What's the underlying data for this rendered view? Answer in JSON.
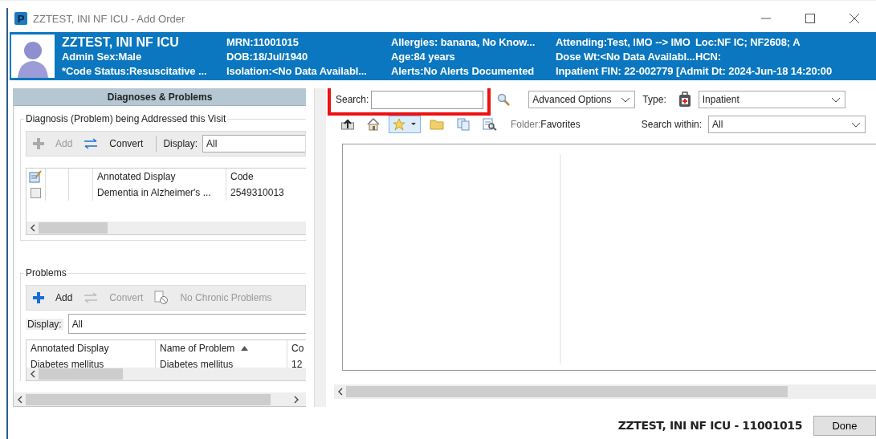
{
  "window": {
    "app_letter": "P",
    "title": "ZZTEST, INI NF ICU - Add Order"
  },
  "banner": {
    "rows": [
      [
        "ZZTEST, INI NF ICU",
        "MRN:11001015",
        "Allergies: banana, No Know...",
        "Attending:Test, IMO --> IMO",
        "Loc:NF IC; NF2608; A"
      ],
      [
        "Admin Sex:Male",
        "DOB:18/Jul/1940",
        "Age:84 years",
        "Dose Wt:<No Data Availabl...",
        "HCN:"
      ],
      [
        "*Code Status:Resuscitative ...",
        "Isolation:<No Data Availabl...",
        "Alerts:No Alerts Documented",
        "Inpatient FIN: 22-002779 [Admit Dt: 2024-Jun-18 14:20:00"
      ]
    ]
  },
  "diagnoses_panel": {
    "title": "Diagnoses & Problems",
    "visit_group": {
      "label": "Diagnosis (Problem) being Addressed this Visit",
      "toolbar": [
        {
          "kind": "plus",
          "label": "Add",
          "disabled": true
        },
        {
          "kind": "convert",
          "label": "Convert",
          "disabled": false
        }
      ],
      "display_label": "Display:",
      "display_value": "All",
      "columns": [
        "Annotated Display",
        "Code"
      ],
      "rows": [
        {
          "checked": false,
          "cells": [
            "Dementia in Alzheimer's ...",
            "2549310013"
          ]
        }
      ]
    },
    "problems_group": {
      "label": "Problems",
      "toolbar": [
        {
          "kind": "plus",
          "label": "Add",
          "disabled": false
        },
        {
          "kind": "convert",
          "label": "Convert",
          "disabled": true
        },
        {
          "kind": "no-chronic",
          "label": "No Chronic Problems",
          "disabled": true
        }
      ],
      "display_label": "Display:",
      "display_value": "All",
      "columns": [
        {
          "label": "Annotated Display"
        },
        {
          "label": "Name of Problem",
          "sorted": true
        },
        {
          "label": "Co"
        }
      ],
      "rows": [
        [
          "Diabetes mellitus",
          "Diabetes mellitus",
          "12"
        ]
      ]
    }
  },
  "order_search": {
    "search_label": "Search:",
    "highlighted": true,
    "advanced_options": "Advanced Options",
    "type_label": "Type:",
    "type_value": "Inpatient",
    "tools": [
      {
        "kind": "up",
        "selected": false
      },
      {
        "kind": "home",
        "selected": false
      },
      {
        "kind": "star",
        "selected": true
      },
      {
        "kind": "folder",
        "selected": false
      },
      {
        "kind": "copy",
        "selected": false
      },
      {
        "kind": "find",
        "selected": false
      }
    ],
    "folder_label": "Folder:",
    "folder_value": "Favorites",
    "search_within_label": "Search within:",
    "search_within_value": "All"
  },
  "footer": {
    "patient": "ZZTEST, INI NF ICU - 11001015",
    "done": "Done"
  }
}
